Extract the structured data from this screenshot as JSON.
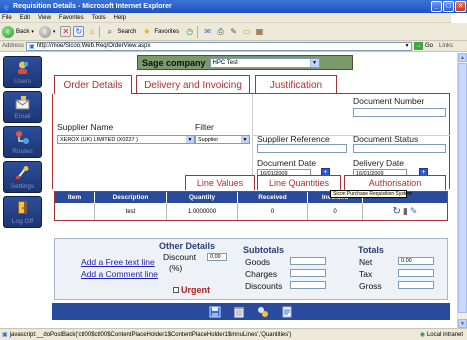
{
  "window": {
    "title": "Requisition Details - Microsoft Internet Explorer",
    "controls": [
      "_",
      "□",
      "✕"
    ]
  },
  "menubar": [
    "File",
    "Edit",
    "View",
    "Favorites",
    "Tools",
    "Help"
  ],
  "toolbar": {
    "back": "Back",
    "search": "Search",
    "favorites": "Favorites"
  },
  "addressbar": {
    "label": "Address",
    "url": "http://moe/Sicon.Web.Req/OrderView.aspx",
    "go": "Go",
    "links": "Links"
  },
  "sidebar": {
    "items": [
      {
        "label": "Users"
      },
      {
        "label": "Email"
      },
      {
        "label": "Routes"
      },
      {
        "label": "Settings"
      },
      {
        "label": "Log Off"
      }
    ]
  },
  "sage": {
    "label": "Sage company",
    "selected": "HPC Test"
  },
  "tabs": [
    {
      "label": "Order Details"
    },
    {
      "label": "Delivery and Invoicing"
    },
    {
      "label": "Justification"
    }
  ],
  "form": {
    "supplier_name_label": "Supplier Name",
    "supplier_name_value": "XEROX (UK) LIMITED (X0227 )",
    "filter_label": "Filter",
    "filter_value": "Supplier",
    "supplier_ref_label": "Supplier Reference",
    "supplier_ref_value": "",
    "doc_number_label": "Document Number",
    "doc_number_value": "",
    "doc_status_label": "Document Status",
    "doc_status_value": "",
    "doc_date_label": "Document Date",
    "doc_date_value": "16/01/2009",
    "delivery_date_label": "Delivery Date",
    "delivery_date_value": "16/01/2009",
    "cal_glyph": "+"
  },
  "line_tabs": [
    {
      "label": "Line Values"
    },
    {
      "label": "Line Quantities"
    },
    {
      "label": "Authorisation"
    }
  ],
  "tooltip": "Sicon Purchase Requisition System",
  "grid": {
    "columns": [
      "Item",
      "Description",
      "Quantity",
      "Received",
      "Invoiced"
    ],
    "rows": [
      {
        "item": "",
        "description": "test",
        "quantity": "1.0000000",
        "received": "0",
        "invoiced": "0"
      }
    ]
  },
  "totals_panel": {
    "add_free_text": "Add a Free text line",
    "add_comment": "Add a Comment line",
    "other_details_title": "Other Details",
    "discount_label": "Discount",
    "discount_unit": "(%)",
    "discount_value": "0.00",
    "urgent_label": "Urgent",
    "subtotals_title": "Subtotals",
    "goods_label": "Goods",
    "charges_label": "Charges",
    "discounts_label": "Discounts",
    "totals_title": "Totals",
    "net_label": "Net",
    "net_value": "0.00",
    "tax_label": "Tax",
    "gross_label": "Gross"
  },
  "statusbar": {
    "text": "javascript:__doPostBack('ctl00$ctl00$ContentPlaceHolder1$ContentPlaceHolder1$mnuLines','Quantities')",
    "zone": "Local intranet"
  },
  "colors": {
    "sidebar_btn": "#2e4e9b",
    "tab_border": "#a33333",
    "grid_header": "#2a4b9b",
    "sage_bar": "#7a9a6c"
  }
}
